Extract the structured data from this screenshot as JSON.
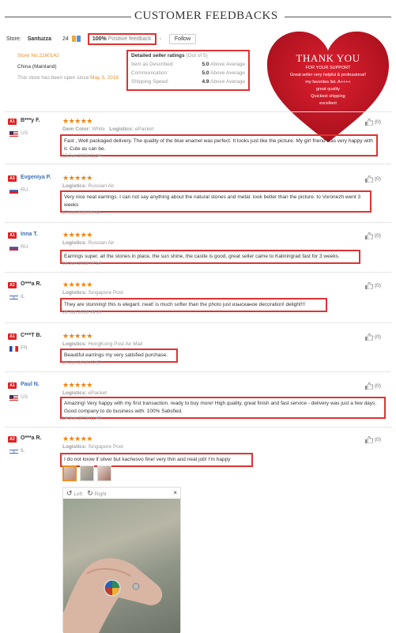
{
  "header": {
    "title": "CUSTOMER FEEDBACKS"
  },
  "store": {
    "label": "Store:",
    "name": "Santuzza",
    "level": "24",
    "positive_pct": "100%",
    "positive_label": "Positive feedback",
    "follow": "Follow",
    "store_no": "Store No.2160142",
    "location": "China (Mainland)",
    "age_text": "This store has been open since",
    "age_value": "May 3, 2016"
  },
  "ratings": {
    "title": "Detailed seller ratings",
    "subtitle": "(Out of 5)",
    "rows": [
      {
        "label": "Item as Described:",
        "value": "5.0",
        "note": "Above Average"
      },
      {
        "label": "Communication:",
        "value": "5.0",
        "note": "Above Average"
      },
      {
        "label": "Shipping Speed:",
        "value": "4.9",
        "note": "Above Average"
      }
    ]
  },
  "thankyou": {
    "title": "THANK YOU",
    "line1": "FOR YOUR SUPPORT",
    "line2": "Great seller very helpful & professional!",
    "line3": "my favorites list. A++++",
    "line4": "great quality",
    "line5": "Quickest shipping",
    "line6": "excellent"
  },
  "reviews": [
    {
      "badge": "A1",
      "name": "B***y F.",
      "country": "US",
      "stars": "★★★★★",
      "meta_label": "Gem Color:",
      "meta_value": "White",
      "meta2_label": "Logistics:",
      "meta2_value": "ePacket",
      "comment": "Fast , Well packaged delivery. The quality of the blue enamel was perfect. It looks just like the picture. My girl friend was very happy with it. Cute as can be.",
      "date": "15 Jun 2018 21:34",
      "likes": "(0)"
    },
    {
      "badge": "A3",
      "name": "Evgeniya P.",
      "country": "RU",
      "stars": "★★★★★",
      "meta_label": "Logistics:",
      "meta_value": "Russian Air",
      "comment": "Very nice neat earrings. I can not say anything about the natural stones and metal. look better than the picture. to Voronezh went 3 weeks",
      "date": "17 Jul 2018 06:42",
      "likes": "(0)"
    },
    {
      "badge": "A1",
      "name": "Inna T.",
      "country": "RU",
      "stars": "★★★★★",
      "meta_label": "Logistics:",
      "meta_value": "Russian Air",
      "comment": "Earrings super, all the stones in place, the sun shine, the castle is good, great seller came to Kaliningrad fast for 3 weeks.",
      "date": "16 Jun 2018 07:57",
      "likes": "(0)"
    },
    {
      "badge": "A2",
      "name": "O***a R.",
      "country": "IL",
      "stars": "★★★★★",
      "meta_label": "Logistics:",
      "meta_value": "Singapore Post",
      "comment": "They are stunning! this is elegant. neat! is much softer than the photo just изысканое decoration! delight!!!",
      "date": "28 Jun 2018 09:20",
      "likes": "(0)"
    },
    {
      "badge": "A1",
      "name": "C***T B.",
      "country": "FR",
      "stars": "★★★★★",
      "meta_label": "Logistics:",
      "meta_value": "HongKong Post Air Mail",
      "comment": "Beautiful earrings my very satisfied purchase.",
      "date": "16 Jun 2018 07:57",
      "likes": "(0)"
    },
    {
      "badge": "A1",
      "name": "Paul N.",
      "country": "US",
      "stars": "★★★★★",
      "meta_label": "Logistics:",
      "meta_value": "ePacket",
      "comment": "Amazing! Very happy with my first transaction. ready to buy more! High quality, great finish and fast service - delivery was just a few days. Good company to do business with. 100% Satisfied.",
      "date": "14 Jun 2018 11:49",
      "likes": "(0)"
    },
    {
      "badge": "A2",
      "name": "O***a R.",
      "country": "IL",
      "stars": "★★★★★",
      "meta_label": "Logistics:",
      "meta_value": "Singapore Post",
      "comment": "I do not know if silver but kachesvo fine! very thin and neat job! I'm happy",
      "likes": "(0)"
    }
  ],
  "viewer": {
    "left": "Left",
    "right": "Right",
    "close": "×"
  }
}
